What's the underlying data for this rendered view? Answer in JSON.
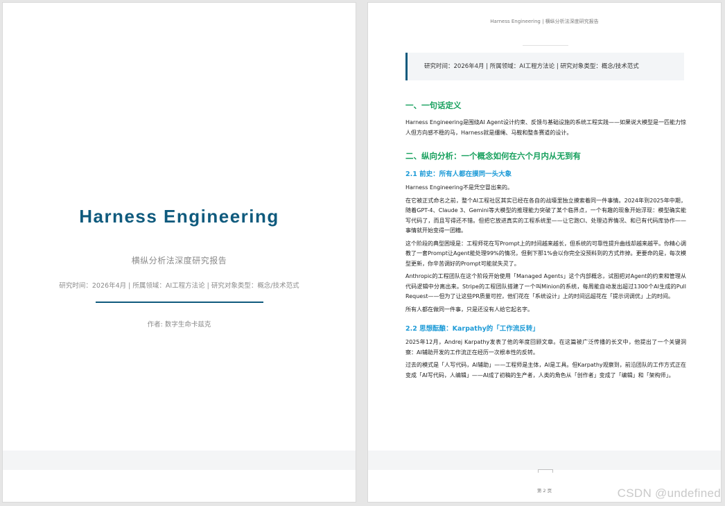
{
  "cover": {
    "title": "Harness Engineering",
    "subtitle": "横纵分析法深度研究报告",
    "meta": "研究时间：2026年4月 | 所属领域：AI工程方法论 | 研究对象类型：概念/技术范式",
    "author": "作者: 数字生命卡兹克"
  },
  "content_page": {
    "running_header": "Harness Engineering | 横纵分析法深度研究报告",
    "meta_box": "研究时间：2026年4月 | 所属领域：AI工程方法论 | 研究对象类型：概念/技术范式",
    "section1": {
      "heading": "一、一句话定义",
      "paragraph": "Harness Engineering是围绕AI Agent设计约束、反馈与基础设施的系统工程实践——如果说大模型是一匹能力惊人但方向感不稳的马，Harness就是缰绳、马鞍和整条赛道的设计。"
    },
    "section2": {
      "heading": "二、纵向分析：一个概念如何在六个月内从无到有",
      "sub1": {
        "heading": "2.1 前史：所有人都在摸同一头大象",
        "paragraphs": [
          "Harness Engineering不是凭空冒出来的。",
          "在它被正式命名之前，整个AI工程社区其实已经在各自的战壕里独立摸索着同一件事情。2024年到2025年中期，随着GPT-4、Claude 3、Gemini等大模型的推理能力突破了某个临界点，一个有趣的现象开始浮现：模型确实能写代码了，而且写得还不错。但把它放进真实的工程系统里——让它跑CI、处理边界情况、和已有代码库协作——事情就开始变得一团糟。",
          "这个阶段的典型困境是：工程师花在写Prompt上的时间越来越长，但系统的可靠性提升曲线却越来越平。你精心调教了一套Prompt让Agent能处理99%的情况，但剩下那1%会以你完全没预料到的方式炸掉。更要命的是，每次模型更新，你辛苦调好的Prompt可能就失灵了。",
          "Anthropic的工程团队在这个阶段开始使用「Managed Agents」这个内部概念，试图把对Agent的约束和管理从代码逻辑中分离出来。Stripe的工程团队搭建了一个叫Minion的系统，每周能自动发出超过1300个AI生成的Pull Request——但为了让这些PR质量可控，他们花在「系统设计」上的时间远超花在「提示词调优」上的时间。",
          "所有人都在做同一件事，只是还没有人给它起名字。"
        ]
      },
      "sub2": {
        "heading": "2.2 思想酝酿：Karpathy的「工作流反转」",
        "paragraphs": [
          "2025年12月，Andrej Karpathy发表了他的年度回顾文章。在这篇被广泛传播的长文中，他提出了一个关键洞察：AI辅助开发的工作流正在经历一次根本性的反转。",
          "过去的模式是「人写代码，AI辅助」——工程师是主体，AI是工具。但Karpathy观察到，前沿团队的工作方式正在变成「AI写代码，人编辑」——AI成了初稿的生产者，人类的角色从「创作者」变成了「编辑」和「架构师」。"
        ]
      }
    },
    "page_number": "第 2 页"
  },
  "watermark": "CSDN @undefined",
  "colors": {
    "title_blue": "#0f5a7d",
    "h1_green": "#17a05d",
    "h2_blue": "#1e9bd7"
  }
}
